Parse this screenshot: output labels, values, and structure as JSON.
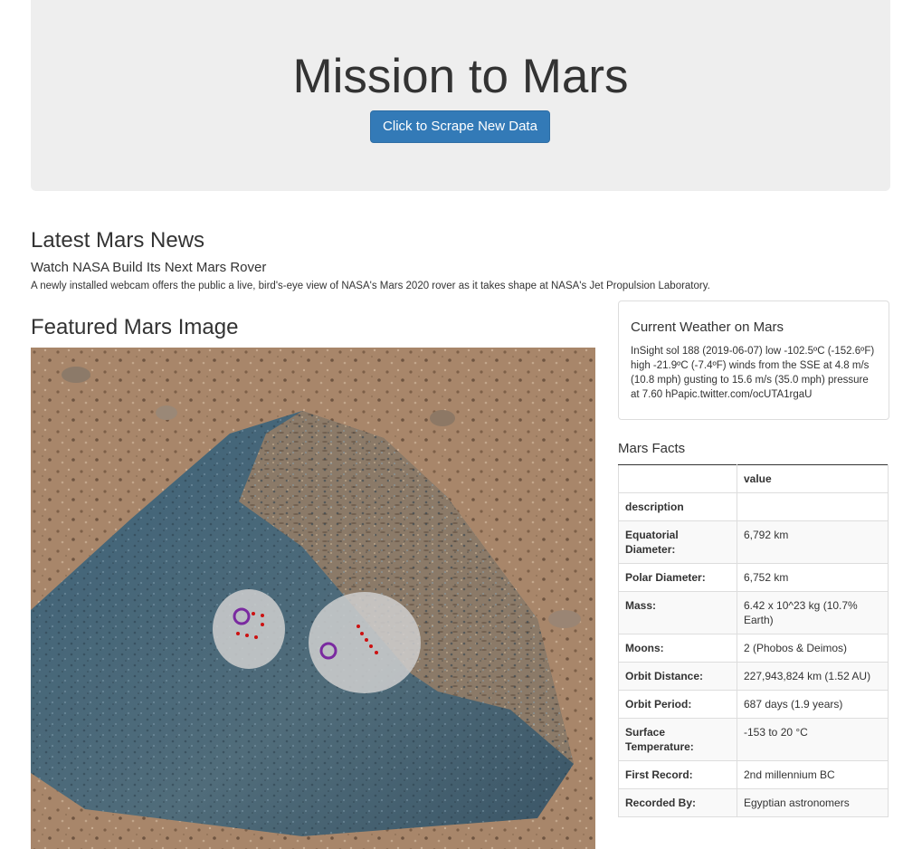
{
  "header": {
    "title": "Mission to Mars",
    "scrape_button": "Click to Scrape New Data"
  },
  "news": {
    "heading": "Latest Mars News",
    "title": "Watch NASA Build Its Next Mars Rover",
    "paragraph": "A newly installed webcam offers the public a live, bird's-eye view of NASA's Mars 2020 rover as it takes shape at NASA's Jet Propulsion Laboratory."
  },
  "featured_image": {
    "heading": "Featured Mars Image"
  },
  "weather": {
    "title": "Current Weather on Mars",
    "text": "InSight sol 188 (2019-06-07) low -102.5ºC (-152.6ºF) high -21.9ºC (-7.4ºF) winds from the SSE at 4.8 m/s (10.8 mph) gusting to 15.6 m/s (35.0 mph) pressure at 7.60 hPapic.twitter.com/ocUTA1rgaU"
  },
  "facts": {
    "heading": "Mars Facts",
    "column_header": "value",
    "index_name": "description",
    "rows": [
      {
        "label": "Equatorial Diameter:",
        "value": "6,792 km"
      },
      {
        "label": "Polar Diameter:",
        "value": "6,752 km"
      },
      {
        "label": "Mass:",
        "value": "6.42 x 10^23 kg (10.7% Earth)"
      },
      {
        "label": "Moons:",
        "value": "2 (Phobos & Deimos)"
      },
      {
        "label": "Orbit Distance:",
        "value": "227,943,824 km (1.52 AU)"
      },
      {
        "label": "Orbit Period:",
        "value": "687 days (1.9 years)"
      },
      {
        "label": "Surface Temperature:",
        "value": "-153 to 20 °C"
      },
      {
        "label": "First Record:",
        "value": "2nd millennium BC"
      },
      {
        "label": "Recorded By:",
        "value": "Egyptian astronomers"
      }
    ]
  }
}
